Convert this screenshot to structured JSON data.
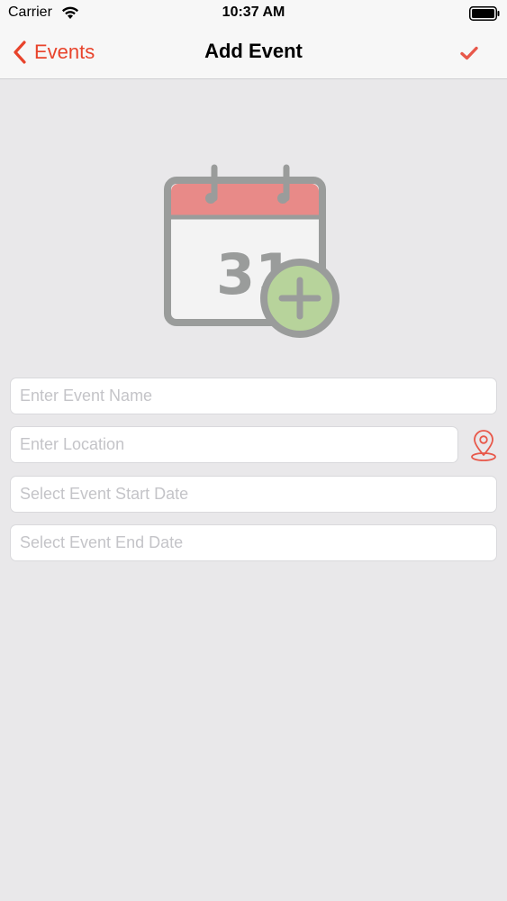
{
  "status_bar": {
    "carrier": "Carrier",
    "time": "10:37 AM"
  },
  "nav": {
    "back_label": "Events",
    "title": "Add Event",
    "done_icon": "checkmark-icon"
  },
  "illustration": {
    "day": "31",
    "icon": "calendar-add-icon"
  },
  "form": {
    "name_placeholder": "Enter Event Name",
    "location_placeholder": "Enter Location",
    "start_placeholder": "Select Event Start Date",
    "end_placeholder": "Select Event End Date",
    "location_icon": "map-pin-icon"
  },
  "colors": {
    "accent": "#e8432b",
    "calendar_header": "#e88a88",
    "calendar_outline": "#9a9c9b",
    "plus_circle": "#b7d39b",
    "background": "#e9e8ea"
  }
}
